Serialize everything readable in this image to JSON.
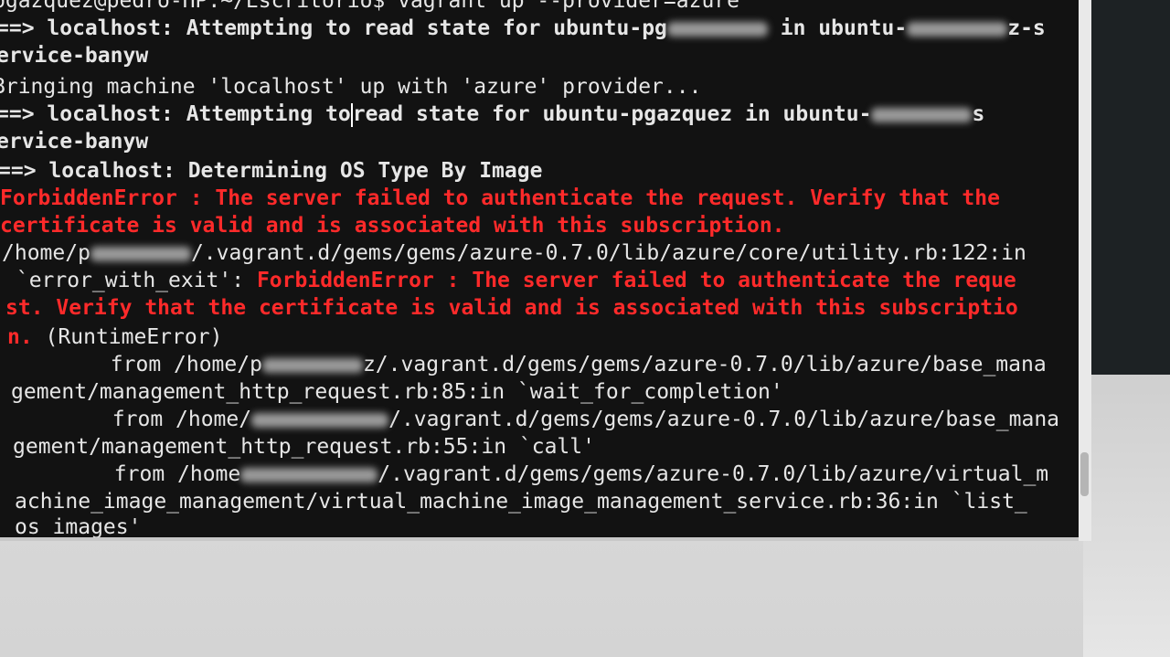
{
  "terminal": {
    "lines": [
      {
        "a": "pgazquez@pedro-HP:~/Escritorio$ vagrant up --provider=azure"
      },
      {
        "a": "==> localhost: Attempting to read state for ubuntu-pg",
        "b": " in ubuntu-",
        "c": "z-s"
      },
      {
        "a": "ervice-banyw"
      },
      {
        "a": "Bringing machine 'localhost' up with 'azure' provider..."
      },
      {
        "a": "==> localhost: Attempting to",
        "b": "read state for ubuntu-pgazquez in ubuntu-",
        "c": "s"
      },
      {
        "a": "ervice-banyw"
      },
      {
        "a": "==> localhost: Determining OS Type By Image"
      },
      {
        "a": "ForbiddenError : The server failed to authenticate the request. Verify that the"
      },
      {
        "a": "certificate is valid and is associated with this subscription."
      },
      {
        "a": "/home/p",
        "b": "/.vagrant.d/gems/gems/azure-0.7.0/lib/azure/core/utility.rb:122:in"
      },
      {
        "a": " `error_with_exit': ",
        "b": "ForbiddenError : The server failed to authenticate the reque"
      },
      {
        "a": "st. Verify that the certificate is valid and is associated with this subscriptio"
      },
      {
        "a": "n.",
        "b": " (RuntimeError)"
      },
      {
        "a": "        from /home/p",
        "b": "z/.vagrant.d/gems/gems/azure-0.7.0/lib/azure/base_mana"
      },
      {
        "a": "gement/management_http_request.rb:85:in `wait_for_completion'"
      },
      {
        "a": "        from /home/",
        "b": "/.vagrant.d/gems/gems/azure-0.7.0/lib/azure/base_mana"
      },
      {
        "a": "gement/management_http_request.rb:55:in `call'"
      },
      {
        "a": "        from /home",
        "b": "/.vagrant.d/gems/gems/azure-0.7.0/lib/azure/virtual_m"
      },
      {
        "a": "achine_image_management/virtual_machine_image_management_service.rb:36:in `list_"
      },
      {
        "a": "os_images'"
      }
    ]
  },
  "colors": {
    "terminal_bg": "#121212",
    "text": "#e6e6e6",
    "error": "#ff2a2a"
  }
}
